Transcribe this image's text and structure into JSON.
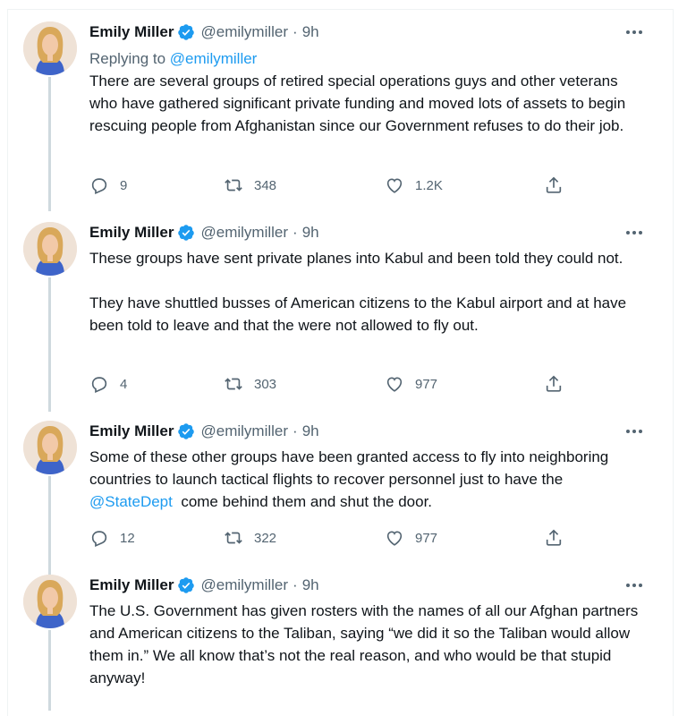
{
  "accent": "#1d9bf0",
  "muted": "#536471",
  "tweets": [
    {
      "name": "Emily Miller",
      "handle": "@emilymiller",
      "separator": "·",
      "time": "9h",
      "replying_prefix": "Replying to",
      "replying_to": "@emilymiller",
      "text": "There are several groups of retired special operations guys and other veterans who have gathered significant private funding and moved lots of assets to begin rescuing people from Afghanistan since our Government refuses to do their job.",
      "replies": "9",
      "retweets": "348",
      "likes": "1.2K"
    },
    {
      "name": "Emily Miller",
      "handle": "@emilymiller",
      "separator": "·",
      "time": "9h",
      "text": "These groups have sent private planes into Kabul and been told they could not.\n\nThey have shuttled busses of American citizens to the Kabul airport and at have been told to leave and that the were not allowed to fly out.",
      "replies": "4",
      "retweets": "303",
      "likes": "977"
    },
    {
      "name": "Emily Miller",
      "handle": "@emilymiller",
      "separator": "·",
      "time": "9h",
      "text_before": "Some of these other groups have been granted access to fly into neighboring countries to launch tactical flights to recover personnel just to have the ",
      "mention": "@StateDept",
      "text_after": "  come behind them and shut the door.",
      "replies": "12",
      "retweets": "322",
      "likes": "977"
    },
    {
      "name": "Emily Miller",
      "handle": "@emilymiller",
      "separator": "·",
      "time": "9h",
      "text": "The U.S. Government has given rosters with the names of all our Afghan partners and American citizens to the Taliban, saying “we did it so the Taliban would allow them in.” We all know that’s not the real reason, and who would be that stupid anyway!"
    }
  ]
}
